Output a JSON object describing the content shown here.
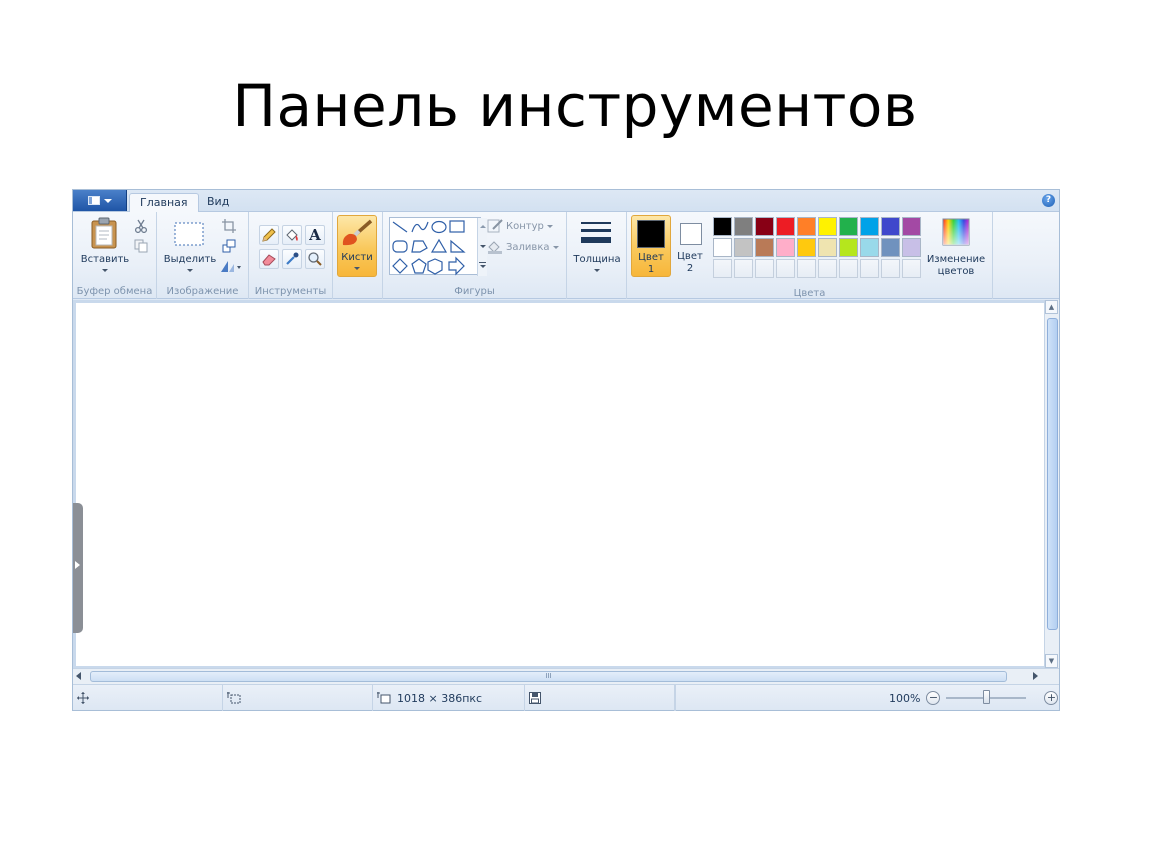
{
  "slide": {
    "title": "Панель инструментов"
  },
  "tabs": [
    {
      "label": "Главная",
      "active": true
    },
    {
      "label": "Вид",
      "active": false
    }
  ],
  "clipboard": {
    "paste_label": "Вставить",
    "group_label": "Буфер обмена"
  },
  "image": {
    "select_label": "Выделить",
    "group_label": "Изображение"
  },
  "tools": {
    "group_label": "Инструменты",
    "text_glyph": "A"
  },
  "brushes": {
    "label": "Кисти"
  },
  "shapes": {
    "outline_label": "Контур",
    "fill_label": "Заливка",
    "group_label": "Фигуры"
  },
  "size": {
    "label": "Толщина"
  },
  "colors": {
    "color1_label_line1": "Цвет",
    "color1_label_line2": "1",
    "color2_label_line1": "Цвет",
    "color2_label_line2": "2",
    "color1": "#000000",
    "color2": "#ffffff",
    "edit_label_line1": "Изменение",
    "edit_label_line2": "цветов",
    "group_label": "Цвета",
    "row1": [
      "#000000",
      "#7f7f7f",
      "#880015",
      "#ed1c24",
      "#ff7f27",
      "#fff200",
      "#22b14c",
      "#00a2e8",
      "#3f48cc",
      "#a349a4"
    ],
    "row2": [
      "#ffffff",
      "#c3c3c3",
      "#b97a57",
      "#ffaec9",
      "#ffc90e",
      "#efe4b0",
      "#b5e61d",
      "#99d9ea",
      "#7092be",
      "#c8bfe7"
    ]
  },
  "statusbar": {
    "canvas_size": "1018 × 386пкс",
    "zoom": "100%",
    "zoom_level": 0.5
  },
  "scrollbar": {
    "grip": "III"
  }
}
